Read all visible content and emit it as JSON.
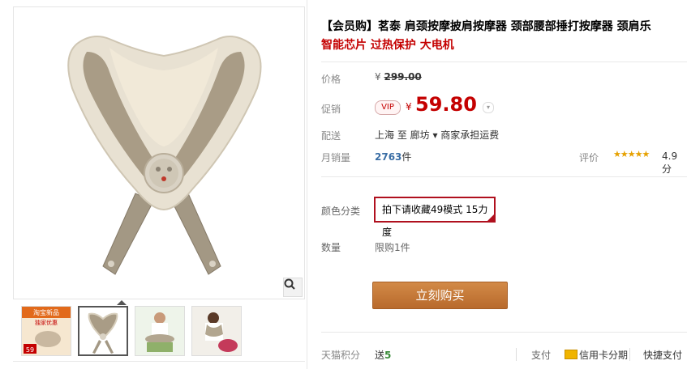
{
  "product": {
    "title": "【会员购】茗泰 肩颈按摩披肩按摩器 颈部腰部捶打按摩器 颈肩乐",
    "subtitle": "智能芯片 过热保护 大电机"
  },
  "price": {
    "label": "价格",
    "original_prefix": "¥",
    "original": "299.00",
    "promo_label": "促销",
    "vip_badge": "VIP",
    "yen": "¥",
    "current": "59.80"
  },
  "shipping": {
    "label": "配送",
    "text": "上海  至   廊坊 ▾  商家承担运费"
  },
  "sales": {
    "label": "月销量",
    "count": "2763",
    "unit": "件",
    "rating_label": "评价",
    "stars": "★★★★★",
    "score": "4.9分"
  },
  "color": {
    "label": "颜色分类",
    "selected_option": "拍下请收藏49模式 15力度"
  },
  "quantity": {
    "label": "数量",
    "limit_text": "限购1件"
  },
  "buy_button_label": "立刻购买",
  "points": {
    "label": "天猫积分",
    "prefix": "送",
    "value": "5"
  },
  "payment": {
    "label": "支付",
    "credit_card": "信用卡分期",
    "quick_pay": "快捷支付"
  },
  "thumbnail_text": {
    "promo_line1": "淘宝新品",
    "promo_line2": "独家优惠",
    "price_tag": "59"
  },
  "colors": {
    "accent_red": "#c40000",
    "buy_button": "#c47a3b",
    "selected_border": "#b0101e",
    "star_gold": "#e6a100"
  }
}
